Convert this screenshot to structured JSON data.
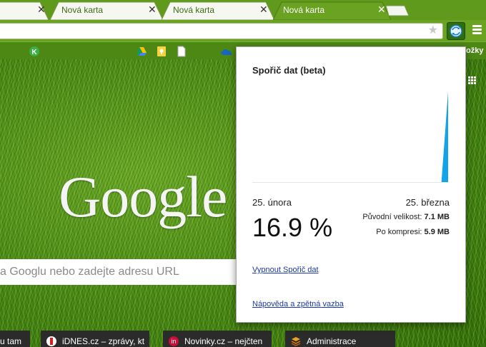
{
  "tabs": [
    {
      "title": "",
      "active": false
    },
    {
      "title": "Nová karta",
      "active": false
    },
    {
      "title": "Nová karta",
      "active": false
    },
    {
      "title": "Nová karta",
      "active": true
    }
  ],
  "tab_close_glyph": "✕",
  "omnibox": {
    "value": ""
  },
  "bookmarks": {
    "overflow_label": "ožky"
  },
  "ntp": {
    "logo_text": "Google",
    "search_placeholder": "a Googlu nebo zadejte adresu URL",
    "tiles": [
      {
        "title": "u tam",
        "favicon_color": ""
      },
      {
        "title": "iDNES.cz – zprávy, kt",
        "favicon_color": "#d81e1e"
      },
      {
        "title": "Novinky.cz – nejčten",
        "favicon_color": "#c8103a"
      },
      {
        "title": "Administrace",
        "favicon_color": "#e08a10"
      }
    ]
  },
  "popup": {
    "title": "Spořič dat (beta)",
    "date_start": "25. února",
    "date_end": "25. března",
    "percent": "16.9 %",
    "original_label": "Původní velikost:",
    "original_value": "7.1 MB",
    "compressed_label": "Po kompresi:",
    "compressed_value": "5.9 MB",
    "disable_link": "Vypnout Spořič dat",
    "help_link": "Nápověda a zpětná vazba"
  },
  "chart_data": {
    "type": "area",
    "x": [
      "25. února",
      "25. března"
    ],
    "series": [
      {
        "values": [
          0,
          0,
          0,
          0,
          0,
          0,
          0,
          0,
          0,
          0,
          0,
          0,
          0,
          0,
          0,
          0,
          0,
          0,
          0,
          0,
          0,
          0,
          0,
          0,
          0,
          0,
          0,
          0,
          0.2,
          100
        ]
      }
    ],
    "ylim": [
      0,
      100
    ],
    "grid": false,
    "color": "#13a3e8"
  },
  "colors": {
    "accent": "#13a3e8",
    "link": "#1a3aa8",
    "chrome_green": "#6aa221"
  },
  "icons": [
    "star-icon",
    "data-saver-icon",
    "menu-icon",
    "apps-grid-icon"
  ]
}
